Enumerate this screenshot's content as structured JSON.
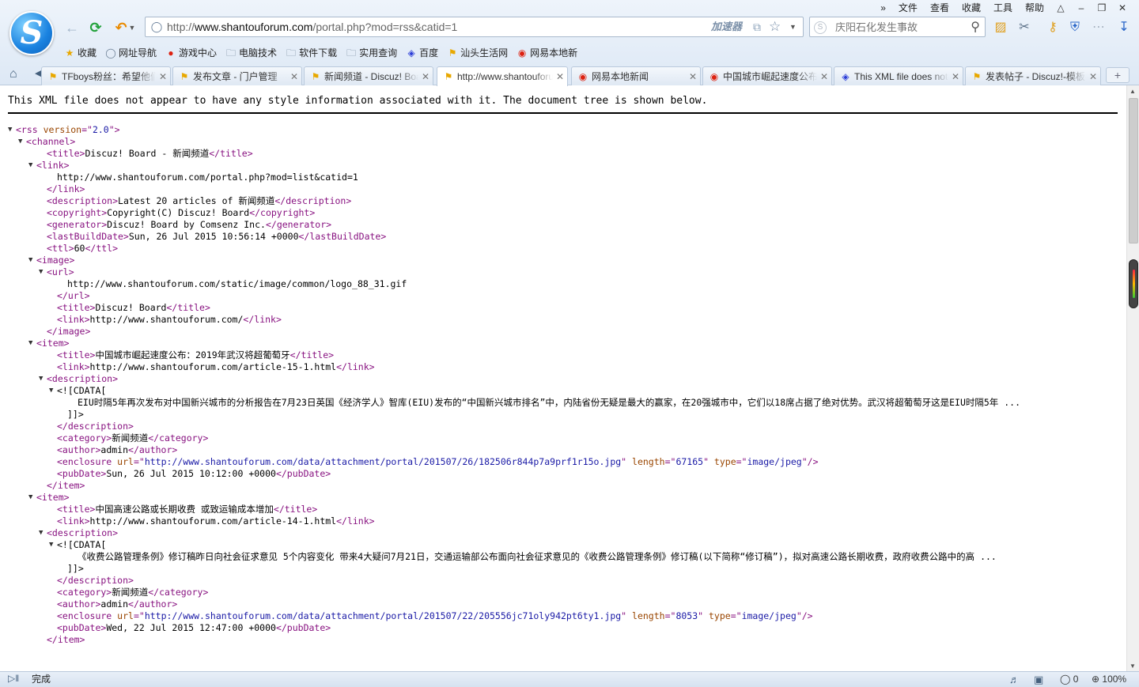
{
  "browser": {
    "logo_letter": "S",
    "menu": [
      "文件",
      "查看",
      "收藏",
      "工具",
      "帮助"
    ],
    "more_glyph": "»",
    "address": {
      "prefix": "http://",
      "domain": "www.shantouforum.com",
      "path": "/portal.php?mod=rss&catid=1",
      "accelerator_label": "加速器"
    },
    "search": {
      "placeholder": "庆阳石化发生事故"
    },
    "favorites": [
      {
        "label": "收藏",
        "icon": "star-icon"
      },
      {
        "label": "网址导航",
        "icon": "globe-icon"
      },
      {
        "label": "游戏中心",
        "icon": "game-icon"
      },
      {
        "label": "电脑技术",
        "icon": "folder-icon"
      },
      {
        "label": "软件下载",
        "icon": "folder-icon"
      },
      {
        "label": "实用查询",
        "icon": "folder-icon"
      },
      {
        "label": "百度",
        "icon": "baidu-paw-icon"
      },
      {
        "label": "汕头生活网",
        "icon": "forum-icon"
      },
      {
        "label": "网易本地新",
        "icon": "netease-icon"
      }
    ],
    "tabs": [
      {
        "label": "TFboys粉丝：希望他们",
        "icon": "discuz-icon",
        "active": false
      },
      {
        "label": "发布文章 - 门户管理",
        "icon": "discuz-icon",
        "active": false
      },
      {
        "label": "新闻频道 - Discuz! Board",
        "icon": "discuz-icon",
        "active": false
      },
      {
        "label": "http://www.shantouforum.com",
        "icon": "discuz-icon",
        "active": true
      },
      {
        "label": "网易本地新闻",
        "icon": "netease-icon",
        "active": false
      },
      {
        "label": "中国城市崛起速度公布",
        "icon": "netease-icon",
        "active": false
      },
      {
        "label": "This XML file does not",
        "icon": "baidu-paw-icon",
        "active": false
      },
      {
        "label": "发表帖子 - Discuz!-模板",
        "icon": "discuz-icon",
        "active": false
      }
    ],
    "newtab_label": "+",
    "status": {
      "text": "完成",
      "blocked_count": "0",
      "zoom": "100%"
    }
  },
  "document": {
    "notice": "This XML file does not appear to have any style information associated with it. The document tree is shown below.",
    "lines": [
      {
        "indent": 0,
        "tri": "▼",
        "parts": [
          [
            "tg",
            "<rss "
          ],
          [
            "at",
            "version"
          ],
          [
            "tg",
            "=\""
          ],
          [
            "av",
            "2.0"
          ],
          [
            "tg",
            "\">"
          ]
        ]
      },
      {
        "indent": 1,
        "tri": "▼",
        "parts": [
          [
            "tg",
            "<channel>"
          ]
        ]
      },
      {
        "indent": 3,
        "parts": [
          [
            "tg",
            "<title>"
          ],
          [
            "tx",
            "Discuz! Board - 新闻频道"
          ],
          [
            "tg",
            "</title>"
          ]
        ]
      },
      {
        "indent": 2,
        "tri": "▼",
        "parts": [
          [
            "tg",
            "<link>"
          ]
        ]
      },
      {
        "indent": 4,
        "parts": [
          [
            "tx",
            "http://www.shantouforum.com/portal.php?mod=list&catid=1"
          ]
        ]
      },
      {
        "indent": 3,
        "parts": [
          [
            "tg",
            "</link>"
          ]
        ]
      },
      {
        "indent": 3,
        "parts": [
          [
            "tg",
            "<description>"
          ],
          [
            "tx",
            "Latest 20 articles of 新闻频道"
          ],
          [
            "tg",
            "</description>"
          ]
        ]
      },
      {
        "indent": 3,
        "parts": [
          [
            "tg",
            "<copyright>"
          ],
          [
            "tx",
            "Copyright(C) Discuz! Board"
          ],
          [
            "tg",
            "</copyright>"
          ]
        ]
      },
      {
        "indent": 3,
        "parts": [
          [
            "tg",
            "<generator>"
          ],
          [
            "tx",
            "Discuz! Board by Comsenz Inc."
          ],
          [
            "tg",
            "</generator>"
          ]
        ]
      },
      {
        "indent": 3,
        "parts": [
          [
            "tg",
            "<lastBuildDate>"
          ],
          [
            "tx",
            "Sun, 26 Jul 2015 10:56:14 +0000"
          ],
          [
            "tg",
            "</lastBuildDate>"
          ]
        ]
      },
      {
        "indent": 3,
        "parts": [
          [
            "tg",
            "<ttl>"
          ],
          [
            "tx",
            "60"
          ],
          [
            "tg",
            "</ttl>"
          ]
        ]
      },
      {
        "indent": 2,
        "tri": "▼",
        "parts": [
          [
            "tg",
            "<image>"
          ]
        ]
      },
      {
        "indent": 3,
        "tri": "▼",
        "parts": [
          [
            "tg",
            "<url>"
          ]
        ]
      },
      {
        "indent": 5,
        "parts": [
          [
            "tx",
            "http://www.shantouforum.com/static/image/common/logo_88_31.gif"
          ]
        ]
      },
      {
        "indent": 4,
        "parts": [
          [
            "tg",
            "</url>"
          ]
        ]
      },
      {
        "indent": 4,
        "parts": [
          [
            "tg",
            "<title>"
          ],
          [
            "tx",
            "Discuz! Board"
          ],
          [
            "tg",
            "</title>"
          ]
        ]
      },
      {
        "indent": 4,
        "parts": [
          [
            "tg",
            "<link>"
          ],
          [
            "tx",
            "http://www.shantouforum.com/"
          ],
          [
            "tg",
            "</link>"
          ]
        ]
      },
      {
        "indent": 3,
        "parts": [
          [
            "tg",
            "</image>"
          ]
        ]
      },
      {
        "indent": 2,
        "tri": "▼",
        "parts": [
          [
            "tg",
            "<item>"
          ]
        ]
      },
      {
        "indent": 4,
        "parts": [
          [
            "tg",
            "<title>"
          ],
          [
            "tx",
            "中国城市崛起速度公布：2019年武汉将超葡萄牙"
          ],
          [
            "tg",
            "</title>"
          ]
        ]
      },
      {
        "indent": 4,
        "parts": [
          [
            "tg",
            "<link>"
          ],
          [
            "tx",
            "http://www.shantouforum.com/article-15-1.html"
          ],
          [
            "tg",
            "</link>"
          ]
        ]
      },
      {
        "indent": 3,
        "tri": "▼",
        "parts": [
          [
            "tg",
            "<description>"
          ]
        ]
      },
      {
        "indent": 4,
        "tri": "▼",
        "parts": [
          [
            "tx",
            "<![CDATA["
          ]
        ]
      },
      {
        "indent": 6,
        "wrap": true,
        "parts": [
          [
            "tx",
            "EIU时隔5年再次发布对中国新兴城市的分析报告在7月23日英国《经济学人》智库(EIU)发布的“中国新兴城市排名”中，内陆省份无疑是最大的赢家，在20强城市中，它们以18席占据了绝对优势。武汉将超葡萄牙这是EIU时隔5年 ..."
          ]
        ]
      },
      {
        "indent": 5,
        "parts": [
          [
            "tx",
            "]]>"
          ]
        ]
      },
      {
        "indent": 4,
        "parts": [
          [
            "tg",
            "</description>"
          ]
        ]
      },
      {
        "indent": 4,
        "parts": [
          [
            "tg",
            "<category>"
          ],
          [
            "tx",
            "新闻频道"
          ],
          [
            "tg",
            "</category>"
          ]
        ]
      },
      {
        "indent": 4,
        "parts": [
          [
            "tg",
            "<author>"
          ],
          [
            "tx",
            "admin"
          ],
          [
            "tg",
            "</author>"
          ]
        ]
      },
      {
        "indent": 4,
        "parts": [
          [
            "tg",
            "<enclosure "
          ],
          [
            "at",
            "url"
          ],
          [
            "tg",
            "=\""
          ],
          [
            "av",
            "http://www.shantouforum.com/data/attachment/portal/201507/26/182506r844p7a9prf1r15o.jpg"
          ],
          [
            "tg",
            "\" "
          ],
          [
            "at",
            "length"
          ],
          [
            "tg",
            "=\""
          ],
          [
            "av",
            "67165"
          ],
          [
            "tg",
            "\" "
          ],
          [
            "at",
            "type"
          ],
          [
            "tg",
            "=\""
          ],
          [
            "av",
            "image/jpeg"
          ],
          [
            "tg",
            "\"/>"
          ]
        ]
      },
      {
        "indent": 4,
        "parts": [
          [
            "tg",
            "<pubDate>"
          ],
          [
            "tx",
            "Sun, 26 Jul 2015 10:12:00 +0000"
          ],
          [
            "tg",
            "</pubDate>"
          ]
        ]
      },
      {
        "indent": 3,
        "parts": [
          [
            "tg",
            "</item>"
          ]
        ]
      },
      {
        "indent": 2,
        "tri": "▼",
        "parts": [
          [
            "tg",
            "<item>"
          ]
        ]
      },
      {
        "indent": 4,
        "parts": [
          [
            "tg",
            "<title>"
          ],
          [
            "tx",
            "中国高速公路或长期收费 或致运输成本增加"
          ],
          [
            "tg",
            "</title>"
          ]
        ]
      },
      {
        "indent": 4,
        "parts": [
          [
            "tg",
            "<link>"
          ],
          [
            "tx",
            "http://www.shantouforum.com/article-14-1.html"
          ],
          [
            "tg",
            "</link>"
          ]
        ]
      },
      {
        "indent": 3,
        "tri": "▼",
        "parts": [
          [
            "tg",
            "<description>"
          ]
        ]
      },
      {
        "indent": 4,
        "tri": "▼",
        "parts": [
          [
            "tx",
            "<![CDATA["
          ]
        ]
      },
      {
        "indent": 6,
        "wrap": true,
        "parts": [
          [
            "tx",
            "《收费公路管理条例》修订稿昨日向社会征求意见 5个内容变化 带来4大疑问7月21日，交通运输部公布面向社会征求意见的《收费公路管理条例》修订稿(以下简称“修订稿”)，拟对高速公路长期收费，政府收费公路中的高 ..."
          ]
        ]
      },
      {
        "indent": 5,
        "parts": [
          [
            "tx",
            "]]>"
          ]
        ]
      },
      {
        "indent": 4,
        "parts": [
          [
            "tg",
            "</description>"
          ]
        ]
      },
      {
        "indent": 4,
        "parts": [
          [
            "tg",
            "<category>"
          ],
          [
            "tx",
            "新闻频道"
          ],
          [
            "tg",
            "</category>"
          ]
        ]
      },
      {
        "indent": 4,
        "parts": [
          [
            "tg",
            "<author>"
          ],
          [
            "tx",
            "admin"
          ],
          [
            "tg",
            "</author>"
          ]
        ]
      },
      {
        "indent": 4,
        "parts": [
          [
            "tg",
            "<enclosure "
          ],
          [
            "at",
            "url"
          ],
          [
            "tg",
            "=\""
          ],
          [
            "av",
            "http://www.shantouforum.com/data/attachment/portal/201507/22/205556jc71oly942pt6ty1.jpg"
          ],
          [
            "tg",
            "\" "
          ],
          [
            "at",
            "length"
          ],
          [
            "tg",
            "=\""
          ],
          [
            "av",
            "8053"
          ],
          [
            "tg",
            "\" "
          ],
          [
            "at",
            "type"
          ],
          [
            "tg",
            "=\""
          ],
          [
            "av",
            "image/jpeg"
          ],
          [
            "tg",
            "\"/>"
          ]
        ]
      },
      {
        "indent": 4,
        "parts": [
          [
            "tg",
            "<pubDate>"
          ],
          [
            "tx",
            "Wed, 22 Jul 2015 12:47:00 +0000"
          ],
          [
            "tg",
            "</pubDate>"
          ]
        ]
      },
      {
        "indent": 3,
        "parts": [
          [
            "tg",
            "</item>"
          ]
        ]
      }
    ]
  }
}
